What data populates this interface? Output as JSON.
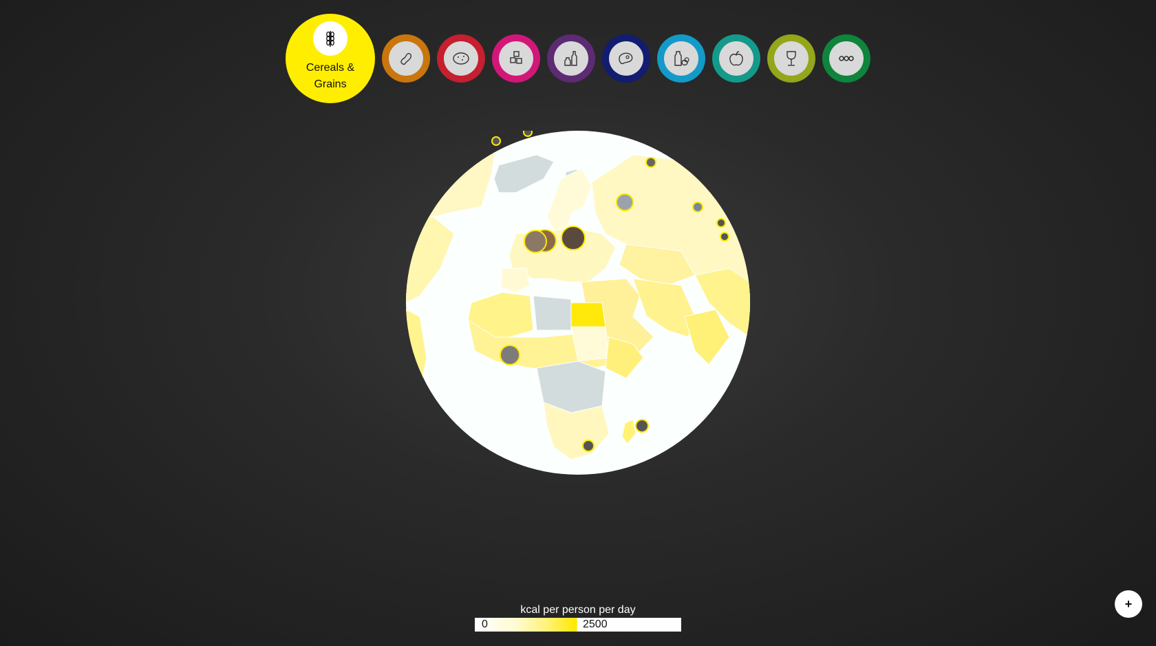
{
  "categories": [
    {
      "id": "cereals",
      "label": "Cereals & Grains",
      "color": "#ffee00",
      "icon": "wheat-icon",
      "active": true
    },
    {
      "id": "pulses",
      "color": "#c8760d",
      "icon": "bean-icon"
    },
    {
      "id": "starchy-roots",
      "color": "#c51f30",
      "icon": "potato-icon"
    },
    {
      "id": "sugar",
      "color": "#d21779",
      "icon": "sugar-cubes-icon"
    },
    {
      "id": "oils",
      "color": "#5c2b74",
      "icon": "oil-bottles-icon"
    },
    {
      "id": "meat",
      "color": "#121c70",
      "icon": "steak-icon"
    },
    {
      "id": "dairy-eggs",
      "color": "#139ac9",
      "icon": "milk-eggs-icon"
    },
    {
      "id": "fruit-veg",
      "color": "#139a8a",
      "icon": "apple-carrot-icon"
    },
    {
      "id": "alcohol",
      "color": "#94a619",
      "icon": "wine-glass-icon"
    },
    {
      "id": "other",
      "color": "#0f843c",
      "icon": "more-dots-icon"
    }
  ],
  "legend": {
    "title": "kcal per person per day",
    "min_label": "0",
    "max_label": "2500",
    "color_min": "#ffffff",
    "color_max": "#ffee00"
  },
  "controls": {
    "zoom_label": "+"
  }
}
